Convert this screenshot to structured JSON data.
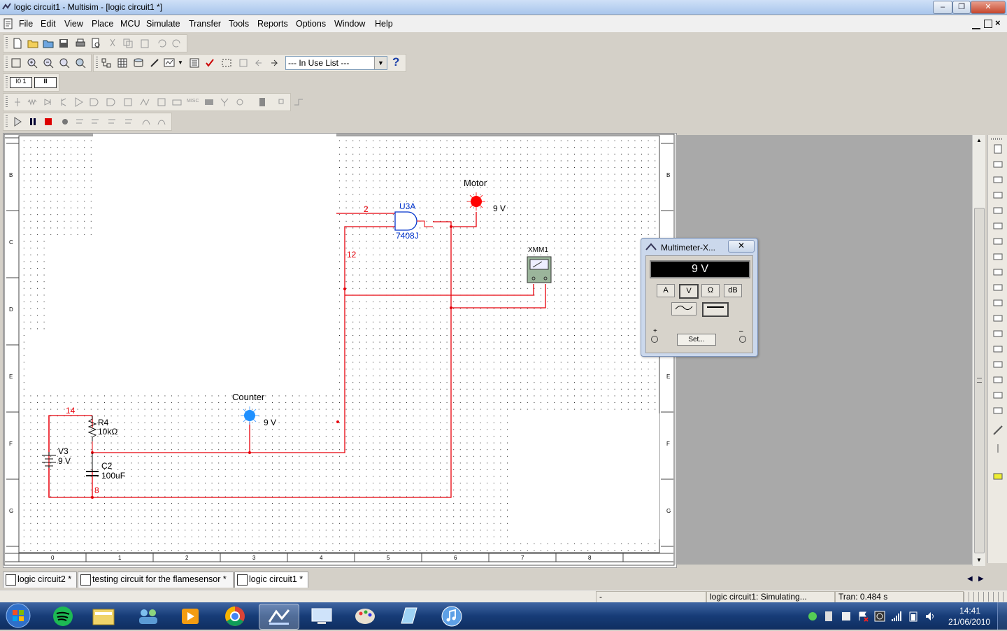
{
  "window": {
    "title": "logic circuit1 - Multisim - [logic circuit1 *]",
    "minimize": "–",
    "restore": "❐",
    "close": "✕"
  },
  "menubar": {
    "items": [
      "File",
      "Edit",
      "View",
      "Place",
      "MCU",
      "Simulate",
      "Transfer",
      "Tools",
      "Reports",
      "Options",
      "Window",
      "Help"
    ]
  },
  "toolbar": {
    "in_use_list": "--- In Use List ---",
    "help_label": "?"
  },
  "schematic": {
    "u3a_ref": "U3A",
    "u3a_part": "7408J",
    "motor_label": "Motor",
    "motor_voltage": "9 V",
    "counter_label": "Counter",
    "counter_voltage": "9 V",
    "xmm_label": "XMM1",
    "r4_ref": "R4",
    "r4_value": "10kΩ",
    "c2_ref": "C2",
    "c2_value": "100uF",
    "v3_ref": "V3",
    "v3_value": "9 V",
    "net_2": "2",
    "net_12": "12",
    "net_14": "14",
    "net_8": "8",
    "border_rows": [
      "B",
      "C",
      "D",
      "E",
      "F",
      "G"
    ],
    "border_cols": [
      "0",
      "1",
      "2",
      "3",
      "4",
      "5",
      "6",
      "7",
      "8"
    ]
  },
  "multimeter": {
    "title": "Multimeter-X...",
    "reading": "9 V",
    "buttons": [
      "A",
      "V",
      "Ω",
      "dB"
    ],
    "set_label": "Set...",
    "plus": "+",
    "minus": "–"
  },
  "tabs": [
    "logic circuit2 *",
    "testing circuit for the flamesensor *",
    "logic circuit1 *"
  ],
  "status": {
    "cell1": "-",
    "cell2": "logic circuit1: Simulating...",
    "cell3": "Tran: 0.484 s"
  },
  "clock": {
    "time": "14:41",
    "date": "21/06/2010"
  },
  "colors": {
    "wire": "#e8000a",
    "blue_text": "#0033cc",
    "probe_red": "#ff0000",
    "probe_blue": "#1e90ff"
  }
}
